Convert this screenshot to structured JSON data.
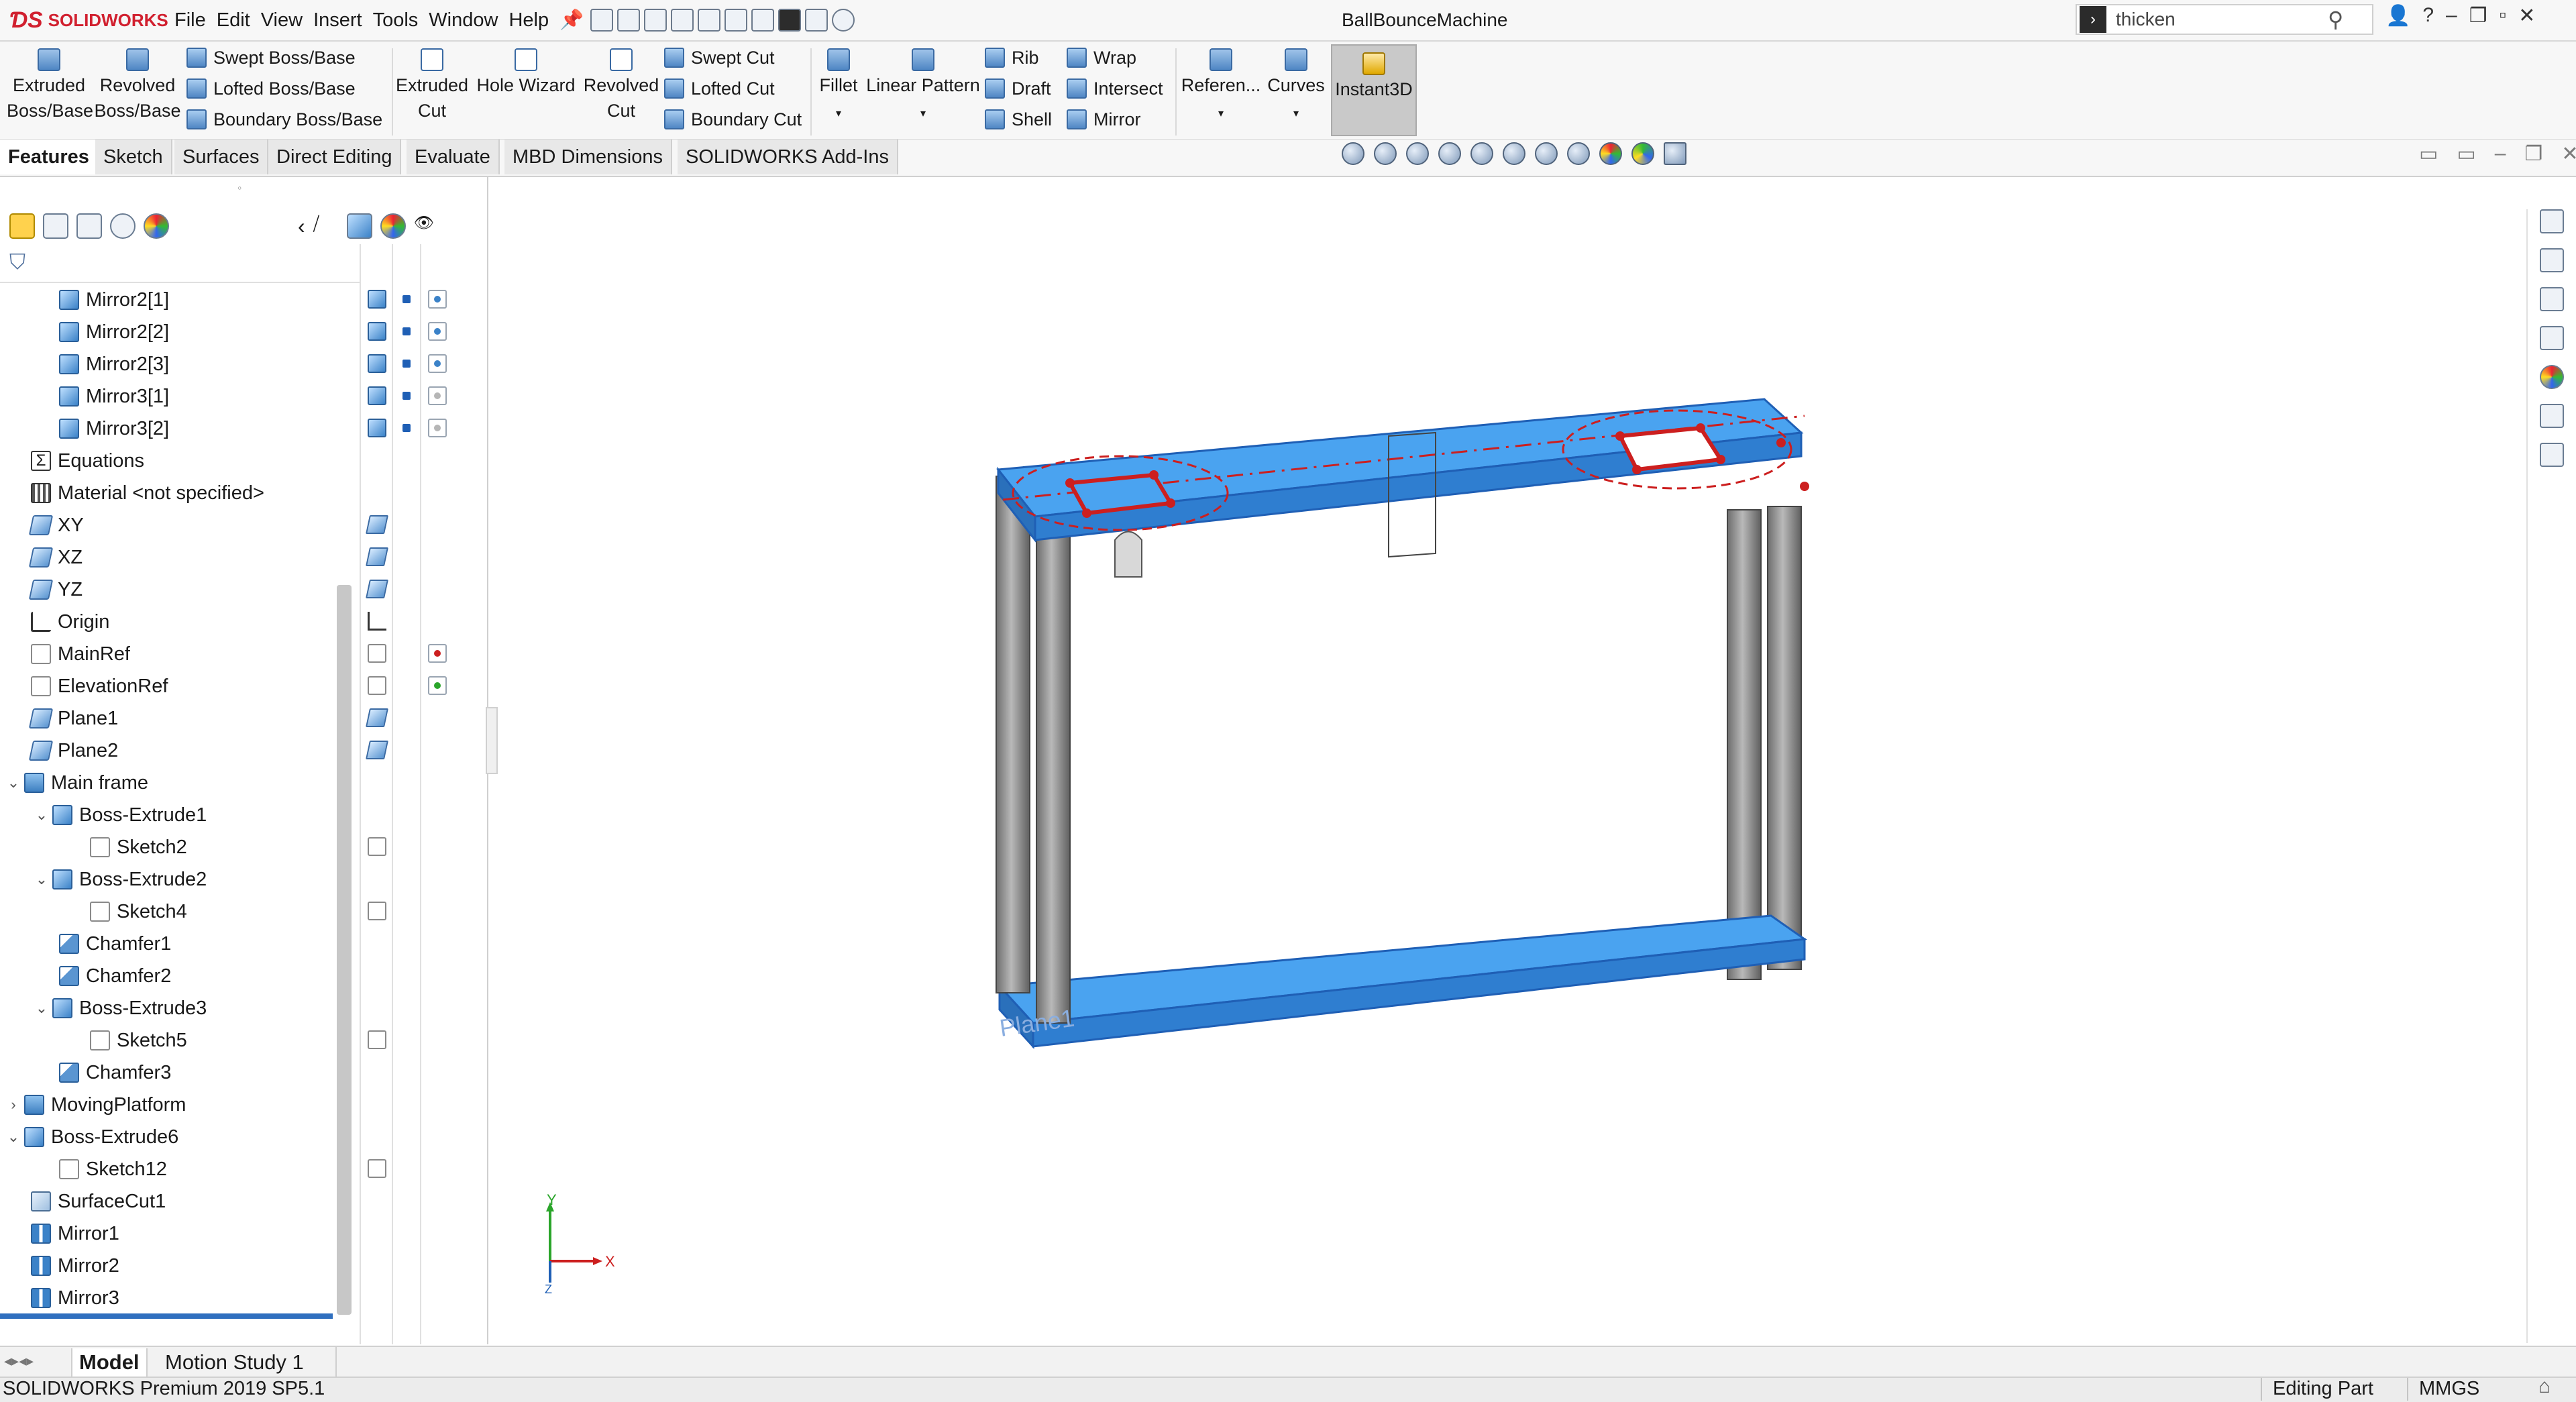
{
  "app": {
    "logo_text": "SOLIDWORKS",
    "menus": [
      "File",
      "Edit",
      "View",
      "Insert",
      "Tools",
      "Window",
      "Help"
    ],
    "document_title": "BallBounceMachine",
    "search": {
      "value": "thicken"
    }
  },
  "command_manager": {
    "extruded_boss": [
      "Extruded",
      "Boss/Base"
    ],
    "revolved_boss": [
      "Revolved",
      "Boss/Base"
    ],
    "swept_boss": "Swept Boss/Base",
    "lofted_boss": "Lofted Boss/Base",
    "boundary_boss": "Boundary Boss/Base",
    "extruded_cut": [
      "Extruded",
      "Cut"
    ],
    "hole_wizard": "Hole Wizard",
    "revolved_cut": [
      "Revolved",
      "Cut"
    ],
    "swept_cut": "Swept Cut",
    "lofted_cut": "Lofted Cut",
    "boundary_cut": "Boundary Cut",
    "fillet": "Fillet",
    "linear_pattern": "Linear Pattern",
    "rib": "Rib",
    "draft": "Draft",
    "shell": "Shell",
    "wrap": "Wrap",
    "intersect": "Intersect",
    "mirror": "Mirror",
    "reference": "Referen...",
    "curves": "Curves",
    "instant3d": "Instant3D"
  },
  "tabs": [
    "Features",
    "Sketch",
    "Surfaces",
    "Direct Editing",
    "Evaluate",
    "MBD Dimensions",
    "SOLIDWORKS Add-Ins"
  ],
  "tree": [
    "Mirror2[1]",
    "Mirror2[2]",
    "Mirror2[3]",
    "Mirror3[1]",
    "Mirror3[2]",
    "Equations",
    "Material <not specified>",
    "XY",
    "XZ",
    "YZ",
    "Origin",
    "MainRef",
    "ElevationRef",
    "Plane1",
    "Plane2",
    "Main frame",
    "Boss-Extrude1",
    "Sketch2",
    "Boss-Extrude2",
    "Sketch4",
    "Chamfer1",
    "Chamfer2",
    "Boss-Extrude3",
    "Sketch5",
    "Chamfer3",
    "MovingPlatform",
    "Boss-Extrude6",
    "Sketch12",
    "SurfaceCut1",
    "Mirror1",
    "Mirror2",
    "Mirror3"
  ],
  "bottom_tabs": [
    "Model",
    "Motion Study 1"
  ],
  "status": {
    "product": "SOLIDWORKS Premium 2019 SP5.1",
    "mode": "Editing Part",
    "units": "MMGS"
  },
  "viewport": {
    "plane_label": "Plane1",
    "triad": {
      "x": "X",
      "y": "Y",
      "z": "Z"
    }
  },
  "colors": {
    "model_body": "#4aa3f0",
    "model_edge": "#1f5fb5",
    "posts": "#8f8f8f",
    "sketch": "#cc1f1f",
    "brand": "#d1202f"
  }
}
